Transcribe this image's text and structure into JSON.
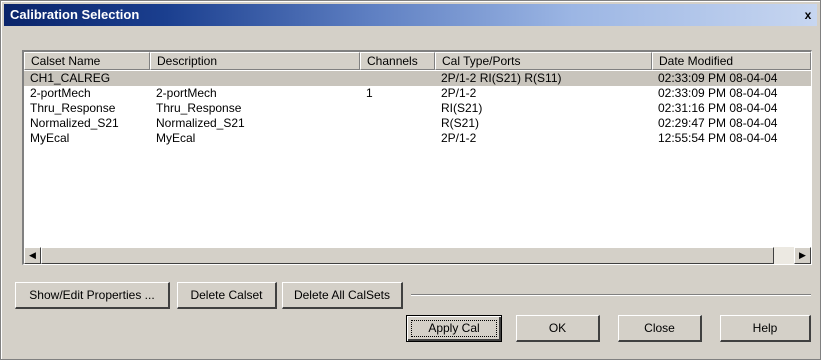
{
  "window": {
    "title": "Calibration Selection",
    "close_glyph": "x"
  },
  "list": {
    "columns": [
      "Calset Name",
      "Description",
      "Channels",
      "Cal Type/Ports",
      "Date Modified"
    ],
    "rows": [
      {
        "name": "CH1_CALREG",
        "description": "",
        "channels": "",
        "cal_type": "2P/1-2 RI(S21) R(S11)",
        "date": "02:33:09 PM  08-04-04",
        "selected": true
      },
      {
        "name": "2-portMech",
        "description": "2-portMech",
        "channels": "1",
        "cal_type": "2P/1-2",
        "date": "02:33:09 PM  08-04-04"
      },
      {
        "name": "Thru_Response",
        "description": "Thru_Response",
        "channels": "",
        "cal_type": "RI(S21)",
        "date": "02:31:16 PM  08-04-04"
      },
      {
        "name": "Normalized_S21",
        "description": "Normalized_S21",
        "channels": "",
        "cal_type": "R(S21)",
        "date": "02:29:47 PM  08-04-04"
      },
      {
        "name": "MyEcal",
        "description": "MyEcal",
        "channels": "",
        "cal_type": "2P/1-2",
        "date": "12:55:54 PM  08-04-04"
      }
    ],
    "scroll_left_glyph": "◀",
    "scroll_right_glyph": "▶"
  },
  "buttons": {
    "show_edit": "Show/Edit Properties ...",
    "delete_calset": "Delete Calset",
    "delete_all": "Delete All CalSets",
    "apply_cal": "Apply Cal",
    "ok": "OK",
    "close": "Close",
    "help": "Help"
  },
  "colors": {
    "title_gradient_start": "#0a246a",
    "title_gradient_end": "#c7d6f0",
    "face": "#d4d0c8",
    "selected_row": "#c8c4bc"
  }
}
